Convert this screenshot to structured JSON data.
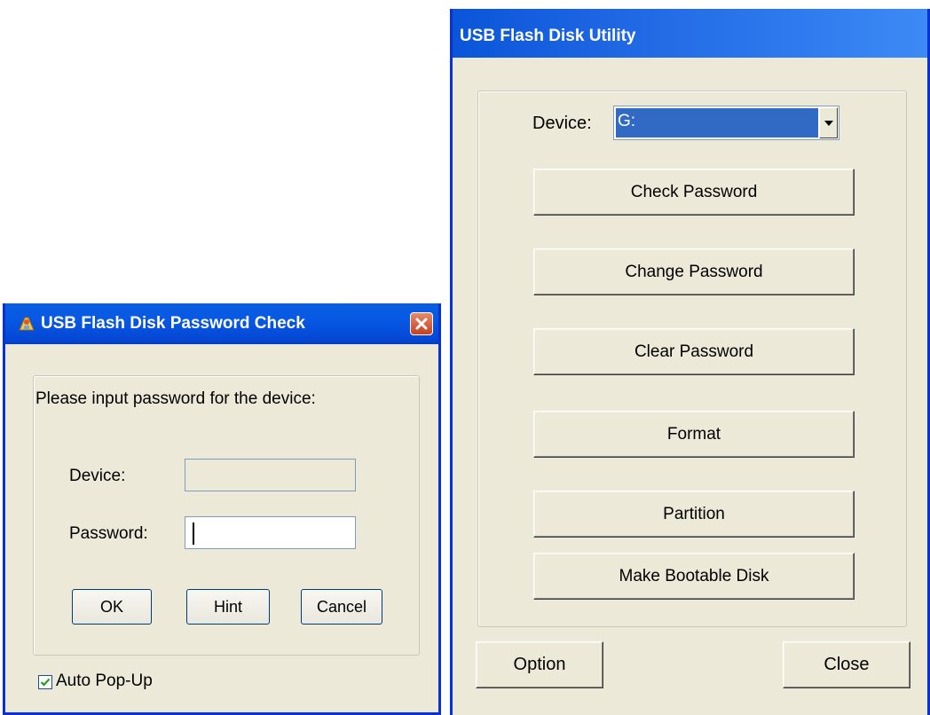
{
  "password_dialog": {
    "title": "USB Flash Disk Password Check",
    "prompt": "Please input password for the device:",
    "device_label": "Device:",
    "device_value": "",
    "password_label": "Password:",
    "password_value": "",
    "buttons": {
      "ok": "OK",
      "hint": "Hint",
      "cancel": "Cancel"
    },
    "auto_popup_label": "Auto Pop-Up",
    "auto_popup_checked": true,
    "icons": {
      "app": "usb-app-icon",
      "close": "close-icon",
      "check": "checkmark-icon"
    }
  },
  "utility_window": {
    "title": "USB Flash Disk Utility",
    "device_label": "Device:",
    "device_selected": "G:",
    "buttons": {
      "check_password": "Check Password",
      "change_password": "Change Password",
      "clear_password": "Clear Password",
      "format": "Format",
      "partition": "Partition",
      "make_bootable": "Make Bootable Disk",
      "option": "Option",
      "close": "Close"
    },
    "icons": {
      "dropdown": "chevron-down-icon"
    }
  },
  "colors": {
    "window_bg": "#ece9d8",
    "titlebar_blue": "#0a5ede",
    "selection_blue": "#316ac5"
  }
}
